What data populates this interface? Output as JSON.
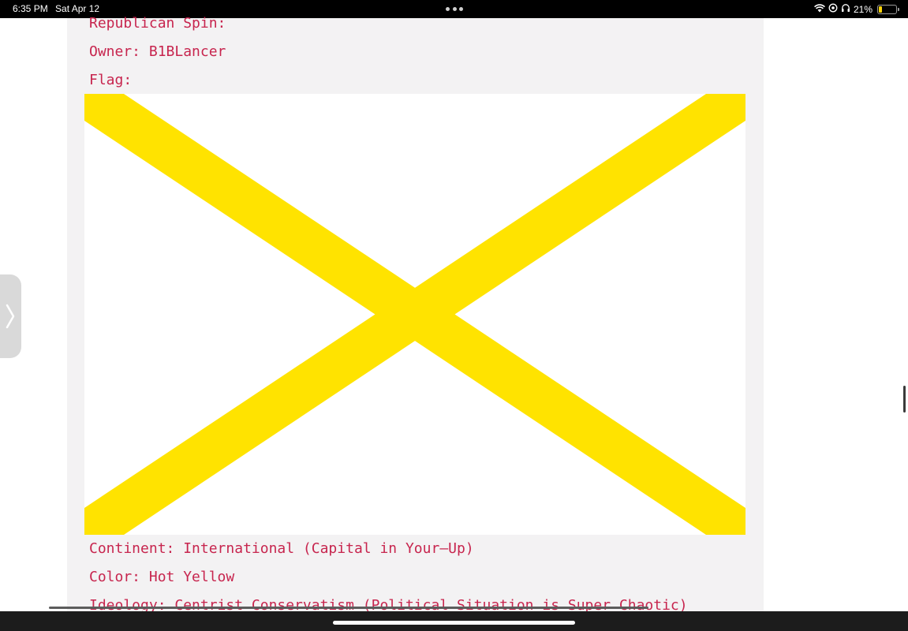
{
  "status_bar": {
    "time": "6:35 PM",
    "date": "Sat Apr 12",
    "battery_text": "21%",
    "battery_level": 0.21,
    "icons": [
      "wifi-icon",
      "location-lock-icon",
      "headphones-icon",
      "battery-icon"
    ]
  },
  "entry": {
    "lines_top": {
      "spin": "Republican Spin:",
      "owner": "Owner: B1BLancer",
      "flag_label": "Flag:"
    },
    "lines_bottom": {
      "continent": "Continent: International (Capital in Your–Up)",
      "color": "Color: Hot Yellow",
      "ideology": "Ideology: Centrist Conservatism (Political Situation is Super Chaotic)"
    }
  },
  "flag": {
    "background": "#ffffff",
    "saltire_color": "#ffe300"
  },
  "colors": {
    "text_accent": "#c7254e",
    "panel_background": "#f3f2f3"
  }
}
